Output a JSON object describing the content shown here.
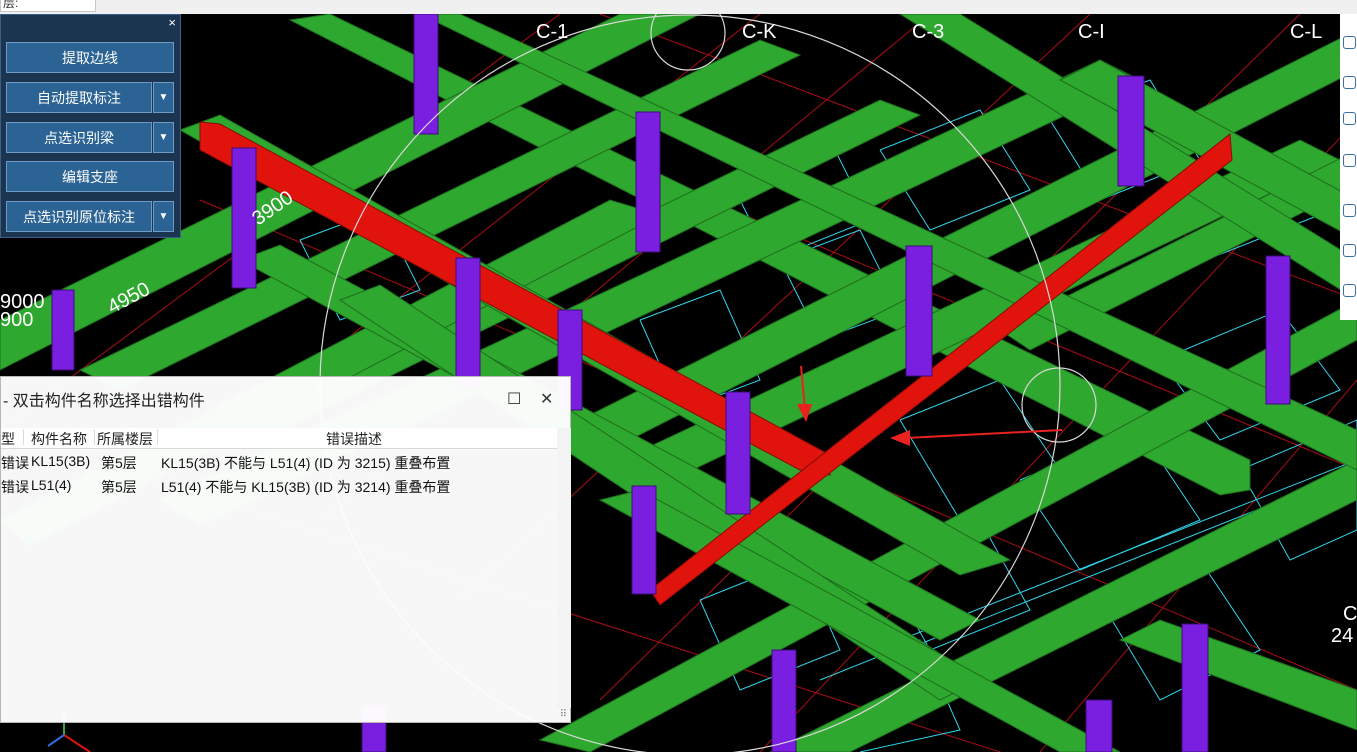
{
  "top_tab": {
    "label": "层:"
  },
  "float_toolbar": {
    "close_label": "×",
    "buttons": [
      {
        "label": "提取边线",
        "dropdown": false
      },
      {
        "label": "自动提取标注",
        "dropdown": true
      },
      {
        "label": "点选识别梁",
        "dropdown": true
      },
      {
        "label": "编辑支座",
        "dropdown": false
      },
      {
        "label": "点选识别原位标注",
        "dropdown": true
      }
    ],
    "dropdown_glyph": "▼"
  },
  "viewport": {
    "axis_labels": [
      "C-1",
      "C-K",
      "C-3",
      "C-I",
      "C-L",
      "C",
      "24"
    ],
    "dimension_labels": [
      "4950",
      "9000",
      "900",
      "3900"
    ],
    "colors": {
      "background": "#000000",
      "beam": "#2fa82f",
      "error_beam": "#e0140d",
      "column": "#7a1fe0",
      "grid_line": "#c8101a",
      "cad_line": "#2fd5ea",
      "annotation_arrow": "#e8231f"
    }
  },
  "error_dialog": {
    "title": "- 双击构件名称选择出错构件",
    "maximize_icon": "☐",
    "close_icon": "✕",
    "columns": [
      "型",
      "构件名称",
      "所属楼层",
      "错误描述"
    ],
    "rows": [
      {
        "type": "错误",
        "name": "KL15(3B)",
        "floor": "第5层",
        "description": "KL15(3B) 不能与 L51(4)  (ID 为 3215)  重叠布置"
      },
      {
        "type": "错误",
        "name": "L51(4)",
        "floor": "第5层",
        "description": "L51(4) 不能与 KL15(3B)  (ID 为 3214)  重叠布置"
      }
    ]
  },
  "right_toolbar": {
    "icons": [
      "orbit-icon",
      "zoom-icon",
      "view-cube-icon",
      "view-box-icon",
      "frame-icon",
      "settings-icon",
      "list-icon"
    ]
  }
}
